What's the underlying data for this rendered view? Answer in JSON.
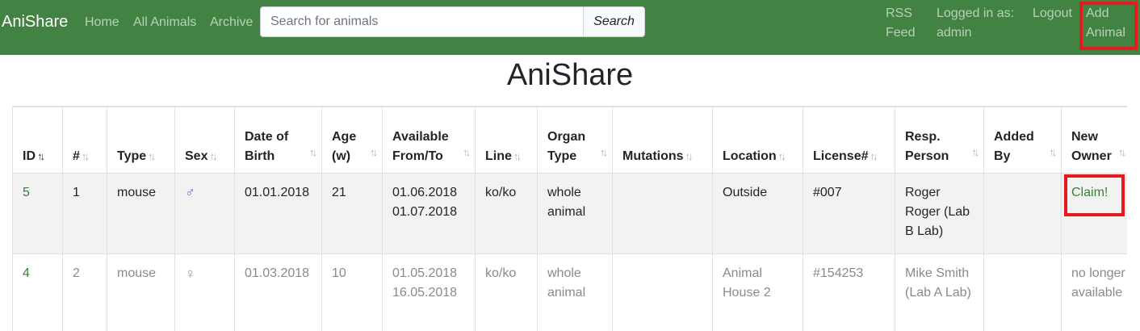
{
  "navbar": {
    "brand": "AniShare",
    "links": {
      "home": "Home",
      "all_animals": "All Animals",
      "archive": "Archive"
    },
    "search": {
      "placeholder": "Search for animals",
      "button": "Search"
    },
    "rss": "RSS Feed",
    "logged_in": "Logged in as: admin",
    "logout": "Logout",
    "add_animal": "Add Animal"
  },
  "page": {
    "title": "AniShare"
  },
  "table": {
    "headers": {
      "id": "ID",
      "num": "#",
      "type": "Type",
      "sex": "Sex",
      "dob": "Date of Birth",
      "age": "Age (w)",
      "available": "Available From/To",
      "line": "Line",
      "organ": "Organ Type",
      "mutations": "Mutations",
      "location": "Location",
      "license": "License#",
      "resp": "Resp. Person",
      "added": "Added By",
      "owner": "New Owner"
    },
    "rows": [
      {
        "id": "5",
        "num": "1",
        "type": "mouse",
        "sex": "♂",
        "dob": "01.01.2018",
        "age": "21",
        "available_from": "01.06.2018",
        "available_to": "01.07.2018",
        "line": "ko/ko",
        "organ": "whole animal",
        "mutations": "",
        "location": "Outside",
        "license": "#007",
        "resp": "Roger Roger (Lab B Lab)",
        "added": "",
        "owner": "Claim!"
      },
      {
        "id": "4",
        "num": "2",
        "type": "mouse",
        "sex": "♀",
        "dob": "01.03.2018",
        "age": "10",
        "available_from": "01.05.2018",
        "available_to": "16.05.2018",
        "line": "ko/ko",
        "organ": "whole animal",
        "mutations": "",
        "location": "Animal House 2",
        "license": "#154253",
        "resp": "Mike Smith (Lab A Lab)",
        "added": "",
        "owner": "no longer available"
      }
    ]
  },
  "colors": {
    "navbar": "#428343",
    "link": "#3b7d3c",
    "highlight": "#e8191c",
    "male": "#6b63d6",
    "female": "#e37e7e"
  }
}
